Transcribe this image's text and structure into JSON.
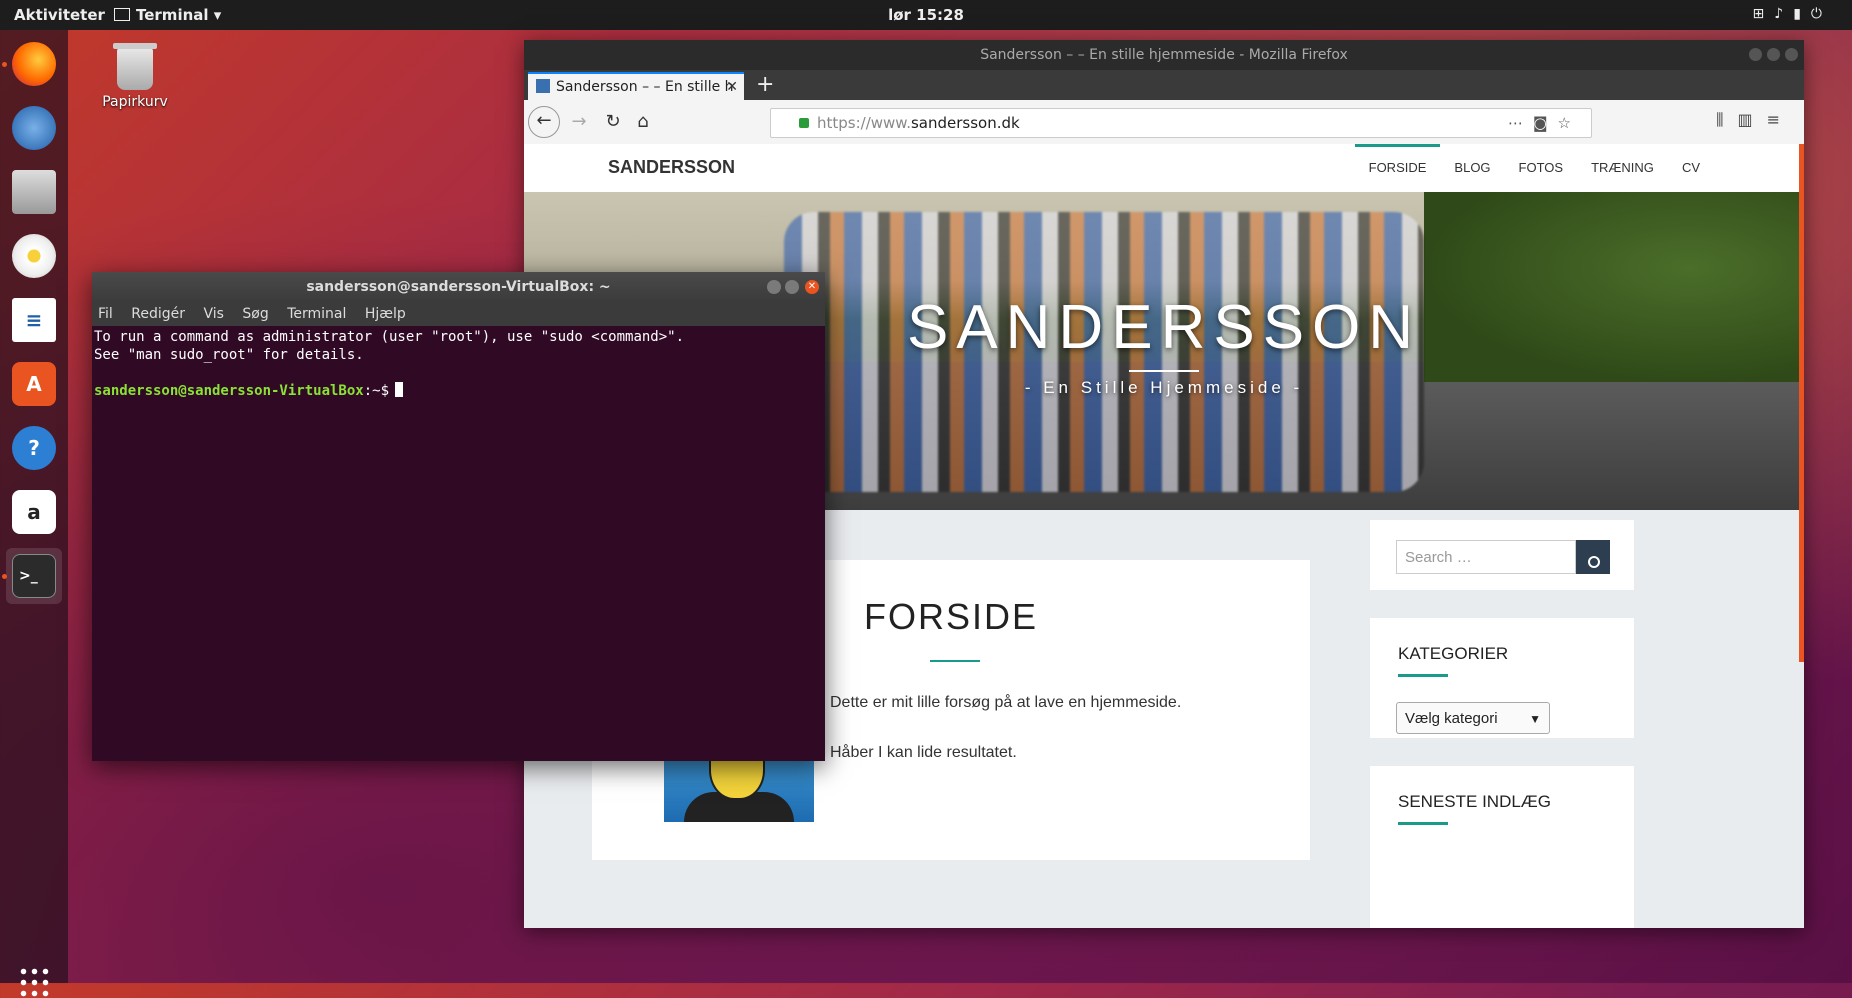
{
  "topbar": {
    "activities": "Aktiviteter",
    "app_menu": "Terminal ▾",
    "clock": "lør 15:28",
    "tray_icons": [
      "network-icon",
      "volume-icon",
      "battery-icon",
      "power-icon"
    ]
  },
  "dock": {
    "items": [
      "firefox",
      "thunderbird",
      "files",
      "rhythmbox",
      "libreoffice-writer",
      "ubuntu-software",
      "help",
      "amazon",
      "terminal"
    ]
  },
  "desktop": {
    "trash_label": "Papirkurv"
  },
  "firefox": {
    "window_title": "Sandersson – – En stille hjemmeside - Mozilla Firefox",
    "tab_title": "Sandersson – – En stille h",
    "url_proto": "https://www.",
    "url_host": "sandersson.dk",
    "site": {
      "logo": "SANDERSSON",
      "menu": [
        "FORSIDE",
        "BLOG",
        "FOTOS",
        "TRÆNING",
        "CV"
      ],
      "hero_title": "SANDERSSON",
      "hero_subtitle": "- En Stille Hjemmeside -",
      "page_title": "FORSIDE",
      "paragraph1": "Dette er mit lille forsøg på at lave en hjemmeside.",
      "paragraph2": "Håber I kan lide resultatet.",
      "search_placeholder": "Search …",
      "categories_title": "KATEGORIER",
      "categories_select": "Vælg kategori",
      "recent_title": "SENESTE INDLÆG"
    }
  },
  "terminal": {
    "window_title": "sandersson@sandersson-VirtualBox: ~",
    "menu": [
      "Fil",
      "Redigér",
      "Vis",
      "Søg",
      "Terminal",
      "Hjælp"
    ],
    "line1": "To run a command as administrator (user \"root\"), use \"sudo <command>\".",
    "line2": "See \"man sudo_root\" for details.",
    "prompt_user": "sandersson@sandersson-VirtualBox",
    "prompt_path": ":~$"
  },
  "colors": {
    "ubuntu_orange": "#e95420",
    "accent_teal": "#1a9a8a",
    "terminal_bg": "#300a24",
    "prompt_green": "#8ae234"
  }
}
